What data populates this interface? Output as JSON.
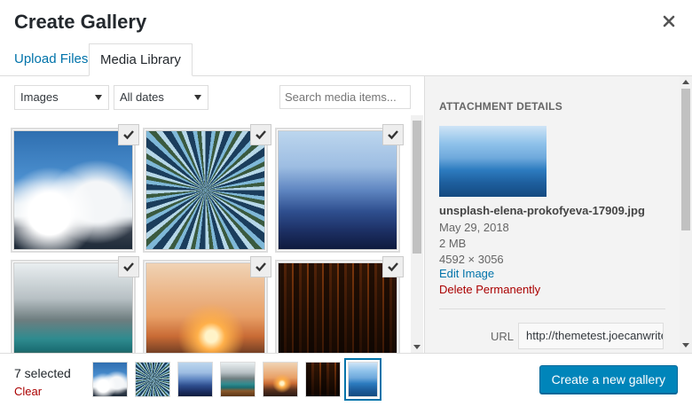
{
  "modal": {
    "title": "Create Gallery",
    "close_icon": "close-icon"
  },
  "tabs": [
    {
      "label": "Upload Files",
      "active": false
    },
    {
      "label": "Media Library",
      "active": true
    }
  ],
  "toolbar": {
    "type_filter": "Images",
    "date_filter": "All dates",
    "search_placeholder": "Search media items..."
  },
  "grid": {
    "items": [
      {
        "name": "clouds-mountains",
        "selected": true
      },
      {
        "name": "forest-canopy",
        "selected": true
      },
      {
        "name": "blue-mountains",
        "selected": true
      },
      {
        "name": "lake-boat",
        "selected": true
      },
      {
        "name": "sunset-hills",
        "selected": true
      },
      {
        "name": "dark-forest",
        "selected": true
      }
    ]
  },
  "attachment": {
    "heading": "Attachment Details",
    "filename": "unsplash-elena-prokofyeva-17909.jpg",
    "date": "May 29, 2018",
    "size": "2 MB",
    "dimensions": "4592 × 3056",
    "edit_label": "Edit Image",
    "delete_label": "Delete Permanently",
    "url_label": "URL",
    "url_value": "http://themetest.joecanwrite"
  },
  "footer": {
    "selected_count": "7 selected",
    "clear_label": "Clear",
    "create_button": "Create a new gallery"
  },
  "colors": {
    "accent": "#0073aa",
    "primary_button": "#0085ba",
    "danger": "#a00"
  }
}
